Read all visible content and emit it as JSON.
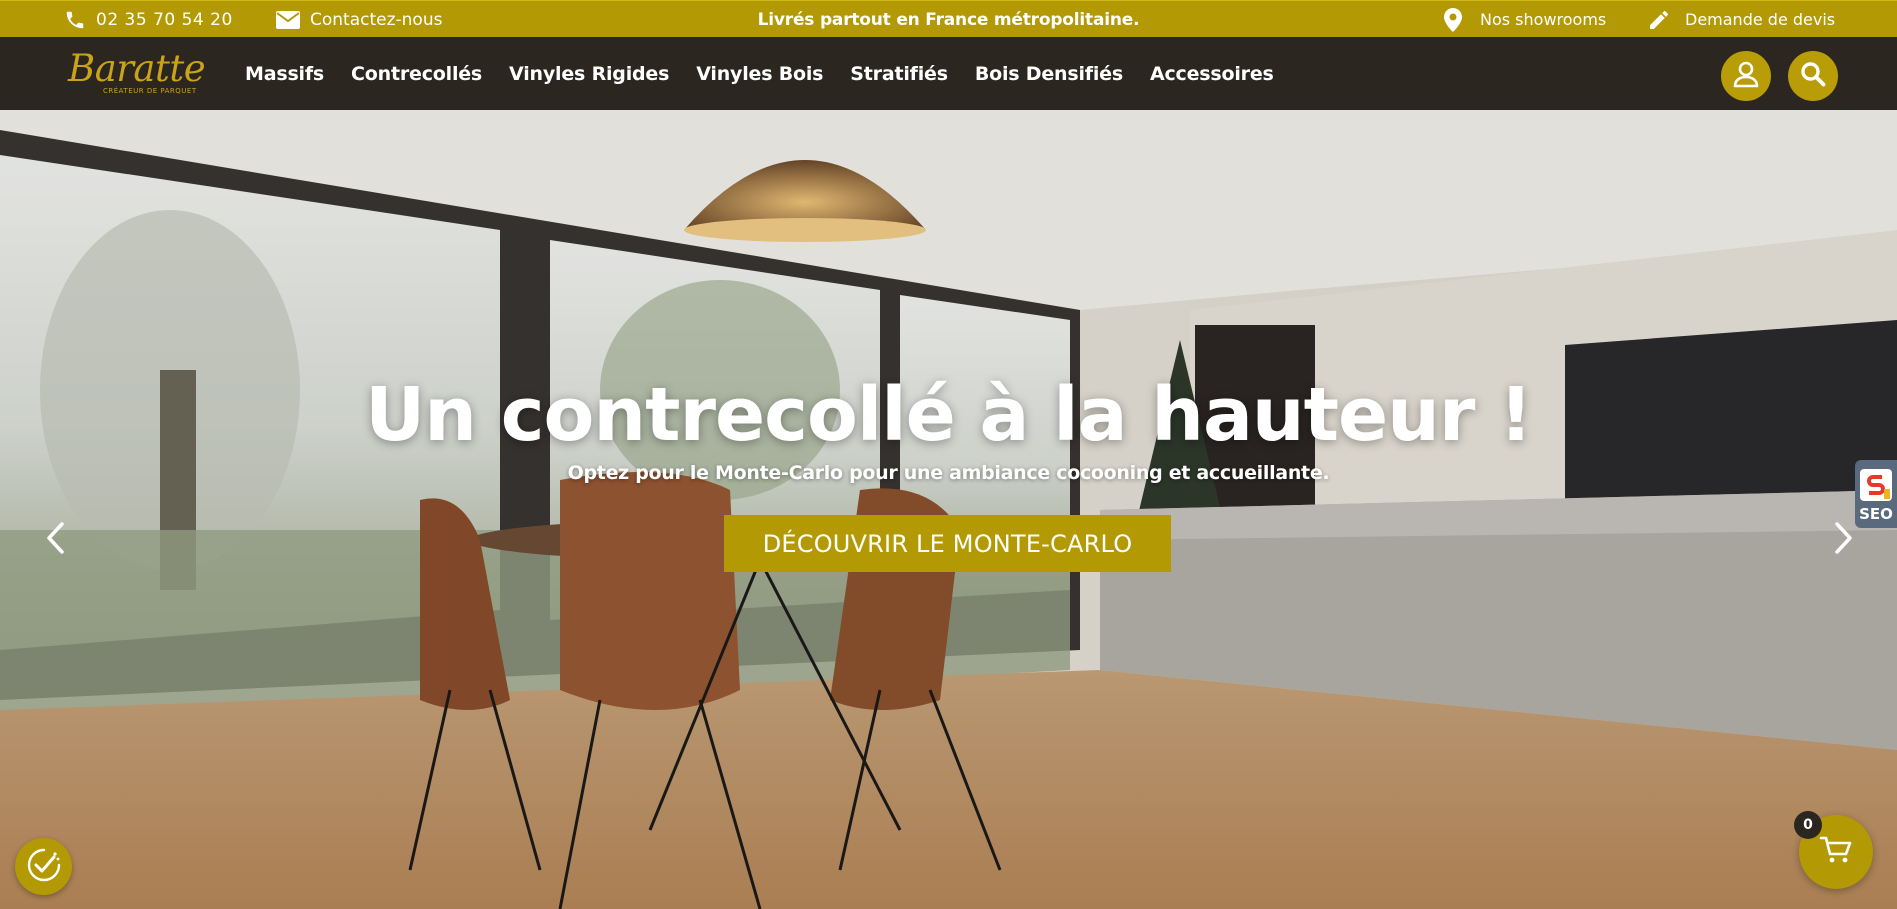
{
  "colors": {
    "accent": "#b39a05",
    "nav_bg": "#2c2620",
    "text_light": "#ffffff"
  },
  "topbar": {
    "phone": "02 35 70 54 20",
    "contact": "Contactez-nous",
    "announcement": "Livrés partout en France métropolitaine.",
    "showrooms": "Nos showrooms",
    "quote": "Demande de devis",
    "icons": {
      "phone": "phone-icon",
      "contact": "envelope-icon",
      "showrooms": "map-pin-icon",
      "quote": "pencil-icon"
    }
  },
  "nav": {
    "logo": {
      "wordmark": "Baratte",
      "tagline": "CRÉATEUR DE PARQUET"
    },
    "items": [
      {
        "label": "Massifs"
      },
      {
        "label": "Contrecollés"
      },
      {
        "label": "Vinyles Rigides"
      },
      {
        "label": "Vinyles Bois"
      },
      {
        "label": "Stratifiés"
      },
      {
        "label": "Bois Densifiés"
      },
      {
        "label": "Accessoires"
      }
    ],
    "icons": {
      "account": "user-icon",
      "search": "search-icon"
    }
  },
  "hero": {
    "title": "Un contrecollé à la hauteur !",
    "subtitle": "Optez pour le Monte-Carlo pour une ambiance cocooning et accueillante.",
    "cta": "DÉCOUVRIR LE MONTE-CARLO",
    "icons": {
      "prev": "chevron-left-icon",
      "next": "chevron-right-icon"
    }
  },
  "widgets": {
    "seo_badge": "SEO",
    "cart_count": "0",
    "icons": {
      "consent": "consent-check-icon",
      "cart": "cart-icon"
    }
  }
}
